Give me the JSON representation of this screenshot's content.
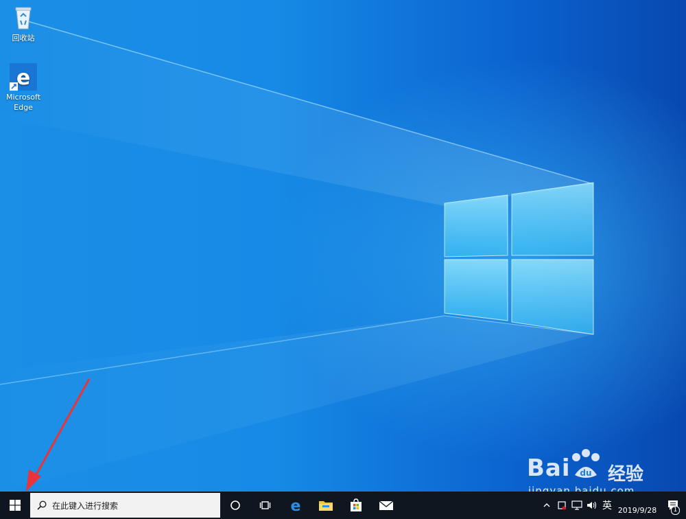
{
  "desktop": {
    "icons": [
      {
        "label": "回收站",
        "icon": "recycle-bin-icon"
      },
      {
        "label": "Microsoft Edge",
        "icon": "edge-icon"
      }
    ]
  },
  "taskbar": {
    "start_icon": "windows-logo-icon",
    "search": {
      "placeholder": "在此键入进行搜索",
      "icon": "search-icon"
    },
    "apps": [
      {
        "name": "cortana",
        "icon": "cortana-circle-icon"
      },
      {
        "name": "task-view",
        "icon": "task-view-icon"
      },
      {
        "name": "edge",
        "icon": "edge-icon"
      },
      {
        "name": "file-explorer",
        "icon": "folder-icon"
      },
      {
        "name": "store",
        "icon": "store-bag-icon"
      },
      {
        "name": "mail",
        "icon": "mail-icon"
      }
    ],
    "tray": {
      "ime_label": "英",
      "clock_date": "2019/9/28",
      "notification_count": "1"
    }
  },
  "watermark": {
    "brand": "Bai",
    "brand_suffix": "经验",
    "url": "jingyan.baidu.com"
  },
  "colors": {
    "taskbar_bg": "#0f1620",
    "desktop_accent": "#168ae6",
    "arrow": "#e8343a"
  }
}
